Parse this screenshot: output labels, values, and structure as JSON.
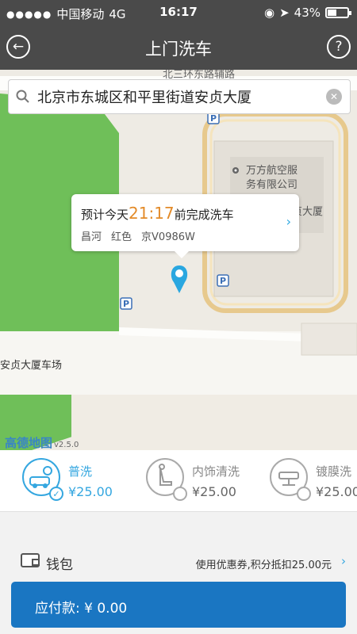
{
  "status_bar": {
    "signal": "●●●●●",
    "carrier": "中国移动",
    "network": "4G",
    "time": "16:17",
    "battery_percent": "43%",
    "battery_level": 0.43
  },
  "nav": {
    "title": "上门洗车"
  },
  "search": {
    "value": "北京市东城区和平里街道安贞大厦"
  },
  "map": {
    "labels": {
      "road": "北三环东路辅路",
      "building": "万方航空服务有限公司",
      "building_partial": "贞大厦",
      "parking_lot": "安贞大厦车场",
      "parking": "P"
    },
    "logo": "高德地图",
    "version": "v2.5.0"
  },
  "bubble": {
    "prefix": "预计今天",
    "eta": "21:17",
    "suffix": "前完成洗车",
    "car_brand": "昌河",
    "car_color": "红色",
    "plate": "京V0986W"
  },
  "services": [
    {
      "name": "普洗",
      "price": "¥25.00",
      "selected": true
    },
    {
      "name": "内饰清洗",
      "price": "¥25.00",
      "selected": false
    },
    {
      "name": "镀膜洗",
      "price": "¥25.00",
      "selected": false
    }
  ],
  "wallet": {
    "label": "钱包",
    "coupon_text": "使用优惠券,积分抵扣25.00元"
  },
  "payment": {
    "label": "应付款: ¥ 0.00"
  },
  "colors": {
    "accent": "#35a7e0",
    "eta": "#e38b29",
    "pay_button": "#1a76c2",
    "header": "#4a4a4a",
    "park": "#6fbf59"
  }
}
